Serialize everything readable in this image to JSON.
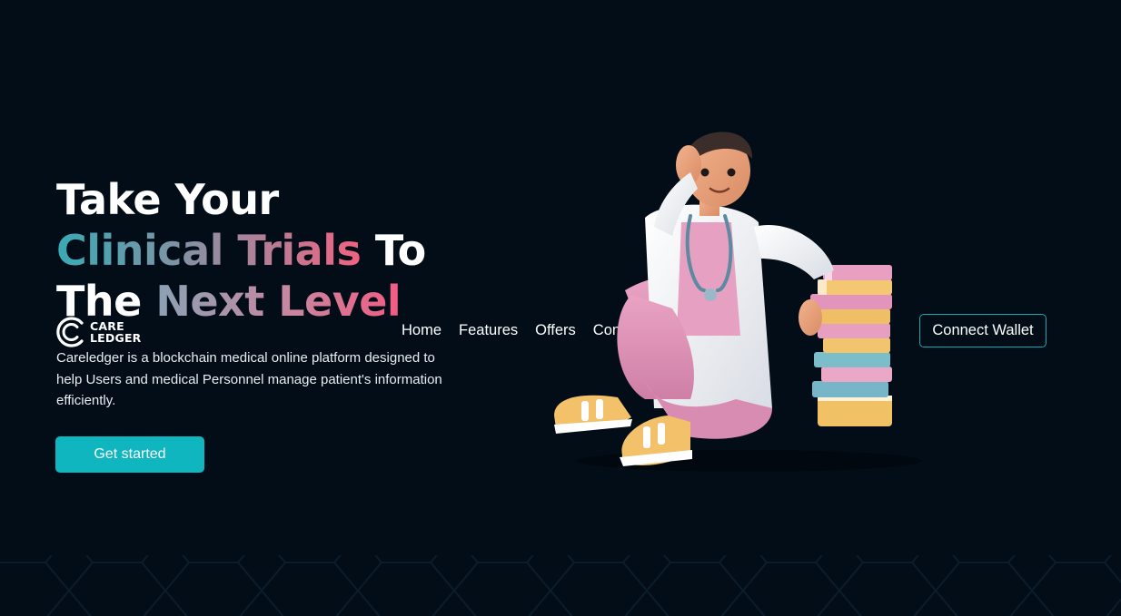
{
  "brand": {
    "logo_line1": "CARE",
    "logo_line2": "LEDGER"
  },
  "nav": {
    "items": [
      {
        "label": "Home"
      },
      {
        "label": "Features"
      },
      {
        "label": "Offers"
      },
      {
        "label": "Contact Us"
      }
    ],
    "connect_wallet_label": "Connect Wallet"
  },
  "hero": {
    "title_line1": "Take Your",
    "title_line2_part1": "Clinical Trials",
    "title_line2_part2": " To",
    "title_line3_part1": "The ",
    "title_line3_part2": "Next Level",
    "description": "Careledger is a blockchain medical online platform designed to help Users and medical Personnel manage patient's information efficiently.",
    "cta_label": "Get started"
  },
  "colors": {
    "background": "#020d18",
    "accent_teal": "#0fb6bf",
    "accent_pink": "#f16281"
  },
  "illustration": {
    "icon": "doctor-with-books-illustration"
  }
}
